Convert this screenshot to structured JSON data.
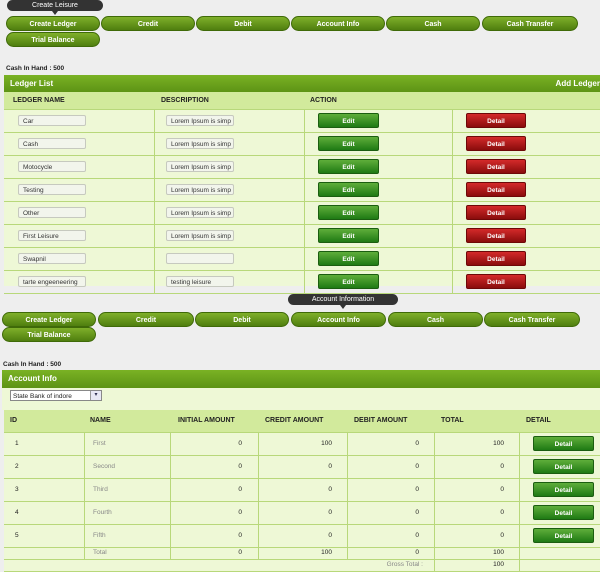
{
  "top": {
    "tooltip": "Create Leisure",
    "nav": [
      "Create Ledger",
      "Credit",
      "Debit",
      "Account Info",
      "Cash",
      "Cash Transfer",
      "Trial Balance"
    ],
    "cash_in_hand": "Cash In Hand : 500",
    "panel_title": "Ledger List",
    "panel_action": "Add Ledger",
    "columns": [
      "LEDGER NAME",
      "DESCRIPTION",
      "ACTION"
    ],
    "edit_label": "Edit",
    "detail_label": "Detail",
    "rows": [
      {
        "name": "Car",
        "desc": "Lorem Ipsum is simp"
      },
      {
        "name": "Cash",
        "desc": "Lorem Ipsum is simp"
      },
      {
        "name": "Motocycle",
        "desc": "Lorem Ipsum is simp"
      },
      {
        "name": "Testing",
        "desc": "Lorem Ipsum is simp"
      },
      {
        "name": "Other",
        "desc": "Lorem Ipsum is simp"
      },
      {
        "name": "First Leisure",
        "desc": "Lorem Ipsum is simp"
      },
      {
        "name": "Swapnil",
        "desc": ""
      },
      {
        "name": "tarte engeeneering",
        "desc": "testing leisure"
      }
    ]
  },
  "bottom": {
    "tooltip": "Account Information",
    "nav": [
      "Create Ledger",
      "Credit",
      "Debit",
      "Account Info",
      "Cash",
      "Cash Transfer",
      "Trial Balance"
    ],
    "cash_in_hand": "Cash In Hand : 500",
    "panel_title": "Account Info",
    "select_value": "State Bank of indore",
    "columns": [
      "ID",
      "NAME",
      "INITIAL AMOUNT",
      "CREDIT AMOUNT",
      "DEBIT AMOUNT",
      "TOTAL",
      "DETAIL"
    ],
    "detail_label": "Detail",
    "rows": [
      {
        "id": "1",
        "name": "First",
        "initial": "0",
        "credit": "100",
        "debit": "0",
        "total": "100"
      },
      {
        "id": "2",
        "name": "Second",
        "initial": "0",
        "credit": "0",
        "debit": "0",
        "total": "0"
      },
      {
        "id": "3",
        "name": "Third",
        "initial": "0",
        "credit": "0",
        "debit": "0",
        "total": "0"
      },
      {
        "id": "4",
        "name": "Fourth",
        "initial": "0",
        "credit": "0",
        "debit": "0",
        "total": "0"
      },
      {
        "id": "5",
        "name": "Fifth",
        "initial": "0",
        "credit": "0",
        "debit": "0",
        "total": "0"
      }
    ],
    "total_row": {
      "label": "Total",
      "initial": "0",
      "credit": "100",
      "debit": "0",
      "total": "100"
    },
    "gross_label": "Gross Total :",
    "gross_value": "100"
  },
  "colors": {
    "accent": "#6aa21c",
    "edit": "#2f8a1f",
    "detail": "#b01515"
  }
}
